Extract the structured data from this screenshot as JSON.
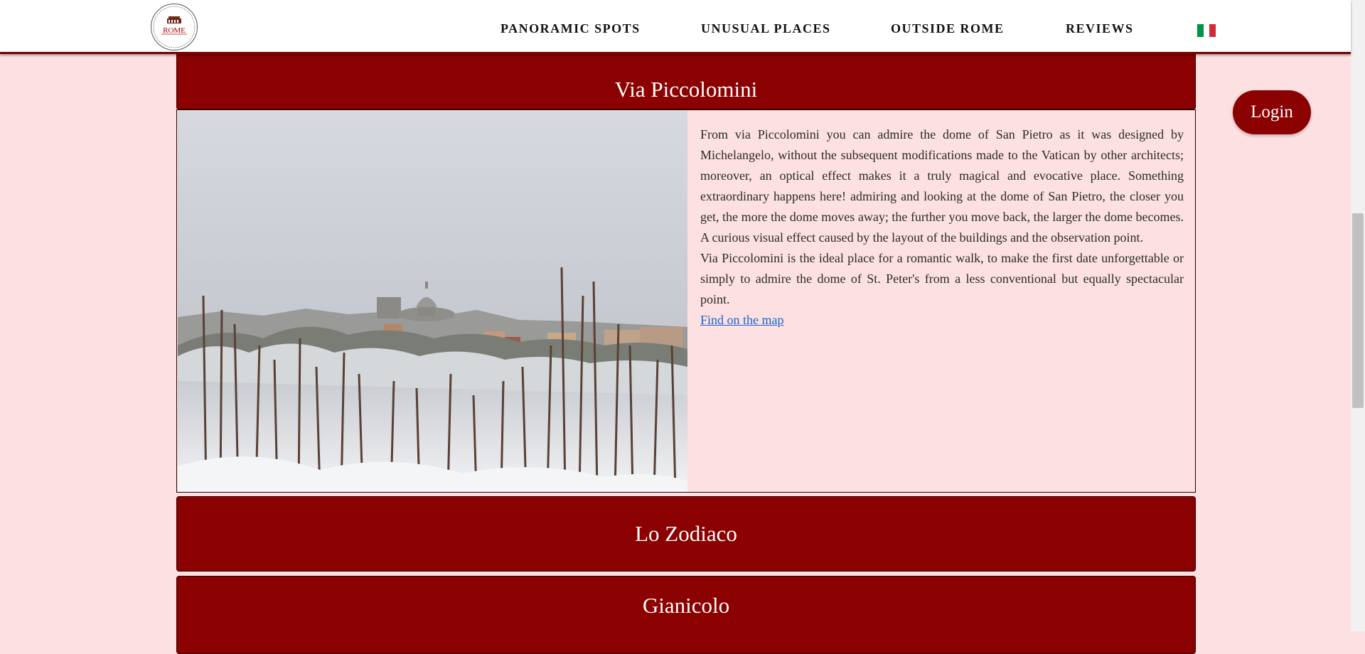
{
  "header": {
    "logo_text": "ROME",
    "nav": [
      {
        "label": "PANORAMIC SPOTS"
      },
      {
        "label": "UNUSUAL PLACES"
      },
      {
        "label": "OUTSIDE ROME"
      },
      {
        "label": "REVIEWS"
      }
    ],
    "language_flag": "italian-flag-icon",
    "colors": {
      "flag_green": "#009246",
      "flag_white": "#ffffff",
      "flag_red": "#ce2b37"
    }
  },
  "login_label": "Login",
  "sections": [
    {
      "title": "Via Piccolomini",
      "paragraphs": [
        "From via Piccolomini you can admire the dome of San Pietro as it was designed by Michelangelo, without the subsequent modifications made to the Vatican by other architects; moreover, an optical effect makes it a truly magical and evocative place. Something extraordinary happens here! admiring and looking at the dome of San Pietro, the closer you get, the more the dome moves away; the further you move back, the larger the dome becomes. A curious visual effect caused by the layout of the buildings and the observation point.",
        "Via Piccolomini is the ideal place for a romantic walk, to make the first date unforgettable or simply to admire the dome of St. Peter's from a less conventional but equally spectacular point."
      ],
      "map_link": "Find on the map"
    },
    {
      "title": "Lo Zodiaco"
    },
    {
      "title": "Gianicolo"
    }
  ],
  "colors": {
    "accent": "#8b0000",
    "background": "#fde0e1",
    "link": "#1a66d6"
  }
}
